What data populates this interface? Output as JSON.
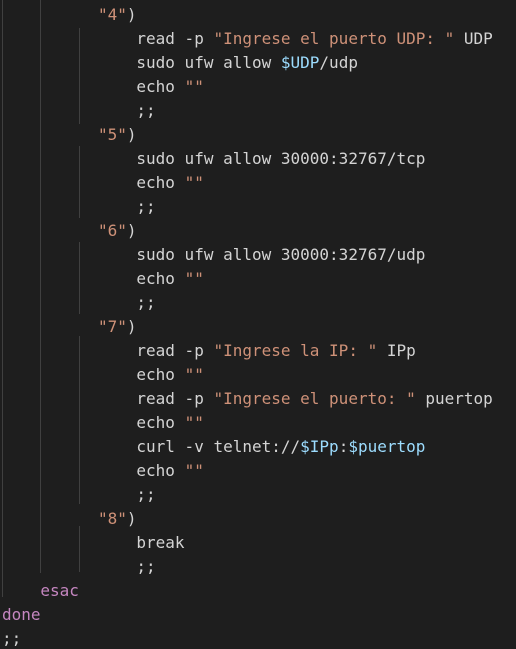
{
  "colors": {
    "background": "#1e1e1e",
    "plain": "#d4d4d4",
    "string": "#ce9178",
    "variable": "#9cdcfe",
    "keyword": "#c586c0",
    "indent_guide": "#404040"
  },
  "code_lines": [
    {
      "indent": 5,
      "tokens": [
        {
          "t": "\"4\"",
          "c": "str"
        },
        {
          "t": ")",
          "c": "plain"
        }
      ]
    },
    {
      "indent": 7,
      "tokens": [
        {
          "t": "read -p ",
          "c": "plain"
        },
        {
          "t": "\"Ingrese el puerto UDP: \"",
          "c": "str"
        },
        {
          "t": " UDP",
          "c": "plain"
        }
      ]
    },
    {
      "indent": 7,
      "tokens": [
        {
          "t": "sudo ufw allow ",
          "c": "plain"
        },
        {
          "t": "$UDP",
          "c": "var"
        },
        {
          "t": "/udp",
          "c": "plain"
        }
      ]
    },
    {
      "indent": 7,
      "tokens": [
        {
          "t": "echo ",
          "c": "plain"
        },
        {
          "t": "\"\"",
          "c": "str"
        }
      ]
    },
    {
      "indent": 7,
      "tokens": [
        {
          "t": ";;",
          "c": "plain"
        }
      ]
    },
    {
      "indent": 5,
      "tokens": [
        {
          "t": "\"5\"",
          "c": "str"
        },
        {
          "t": ")",
          "c": "plain"
        }
      ]
    },
    {
      "indent": 7,
      "tokens": [
        {
          "t": "sudo ufw allow 30000:32767/tcp",
          "c": "plain"
        }
      ]
    },
    {
      "indent": 7,
      "tokens": [
        {
          "t": "echo ",
          "c": "plain"
        },
        {
          "t": "\"\"",
          "c": "str"
        }
      ]
    },
    {
      "indent": 7,
      "tokens": [
        {
          "t": ";;",
          "c": "plain"
        }
      ]
    },
    {
      "indent": 5,
      "tokens": [
        {
          "t": "\"6\"",
          "c": "str"
        },
        {
          "t": ")",
          "c": "plain"
        }
      ]
    },
    {
      "indent": 7,
      "tokens": [
        {
          "t": "sudo ufw allow 30000:32767/udp",
          "c": "plain"
        }
      ]
    },
    {
      "indent": 7,
      "tokens": [
        {
          "t": "echo ",
          "c": "plain"
        },
        {
          "t": "\"\"",
          "c": "str"
        }
      ]
    },
    {
      "indent": 7,
      "tokens": [
        {
          "t": ";;",
          "c": "plain"
        }
      ]
    },
    {
      "indent": 5,
      "tokens": [
        {
          "t": "\"7\"",
          "c": "str"
        },
        {
          "t": ")",
          "c": "plain"
        }
      ]
    },
    {
      "indent": 7,
      "tokens": [
        {
          "t": "read -p ",
          "c": "plain"
        },
        {
          "t": "\"Ingrese la IP: \"",
          "c": "str"
        },
        {
          "t": " IPp",
          "c": "plain"
        }
      ]
    },
    {
      "indent": 7,
      "tokens": [
        {
          "t": "echo ",
          "c": "plain"
        },
        {
          "t": "\"\"",
          "c": "str"
        }
      ]
    },
    {
      "indent": 7,
      "tokens": [
        {
          "t": "read -p ",
          "c": "plain"
        },
        {
          "t": "\"Ingrese el puerto: \"",
          "c": "str"
        },
        {
          "t": " puertop",
          "c": "plain"
        }
      ]
    },
    {
      "indent": 7,
      "tokens": [
        {
          "t": "echo ",
          "c": "plain"
        },
        {
          "t": "\"\"",
          "c": "str"
        }
      ]
    },
    {
      "indent": 7,
      "tokens": [
        {
          "t": "curl -v telnet://",
          "c": "plain"
        },
        {
          "t": "$IPp",
          "c": "var"
        },
        {
          "t": ":",
          "c": "plain"
        },
        {
          "t": "$puertop",
          "c": "var"
        }
      ]
    },
    {
      "indent": 7,
      "tokens": [
        {
          "t": "echo ",
          "c": "plain"
        },
        {
          "t": "\"\"",
          "c": "str"
        }
      ]
    },
    {
      "indent": 7,
      "tokens": [
        {
          "t": ";;",
          "c": "plain"
        }
      ]
    },
    {
      "indent": 5,
      "tokens": [
        {
          "t": "\"8\"",
          "c": "str"
        },
        {
          "t": ")",
          "c": "plain"
        }
      ]
    },
    {
      "indent": 7,
      "tokens": [
        {
          "t": "break",
          "c": "plain"
        }
      ]
    },
    {
      "indent": 7,
      "tokens": [
        {
          "t": ";;",
          "c": "plain"
        }
      ]
    },
    {
      "indent": 2,
      "tokens": [
        {
          "t": "esac",
          "c": "kw"
        }
      ]
    },
    {
      "indent": 0,
      "tokens": [
        {
          "t": "done",
          "c": "kw"
        }
      ]
    },
    {
      "indent": 0,
      "tokens": [
        {
          "t": ";;",
          "c": "plain"
        }
      ]
    }
  ]
}
